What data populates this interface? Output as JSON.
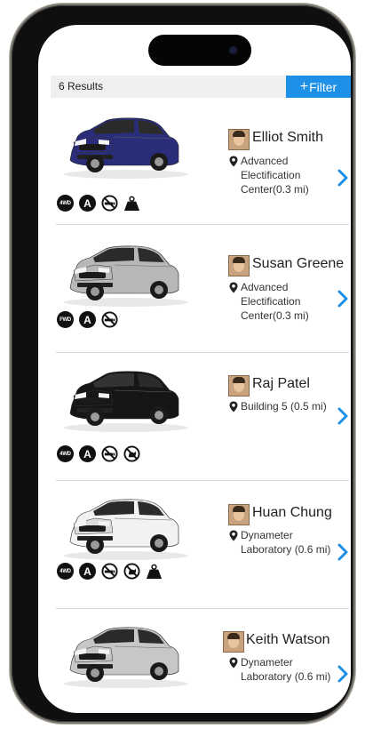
{
  "header": {
    "results_label": "6 Results",
    "filter_label": "Filter"
  },
  "colors": {
    "accent": "#1e90e8"
  },
  "vehicles": [
    {
      "driver": "Elliot Smith",
      "location_lines": [
        "Advanced",
        "Electification",
        "Center(0.3 mi)"
      ],
      "car_color": "#2a2e7a",
      "features": [
        "4WD",
        "A",
        "no-smoking-icon",
        "weight-icon"
      ]
    },
    {
      "driver": "Susan Greene",
      "location_lines": [
        "Advanced",
        "Electification",
        "Center(0.3 mi)"
      ],
      "car_color": "#b7b7b7",
      "features": [
        "FWD",
        "A",
        "no-smoking-icon"
      ]
    },
    {
      "driver": "Raj Patel",
      "location_lines": [
        "Building 5 (0.5 mi)"
      ],
      "car_color": "#161616",
      "features": [
        "4WD",
        "A",
        "no-smoking-icon",
        "no-pets-icon"
      ]
    },
    {
      "driver": "Huan Chung",
      "location_lines": [
        "Dynameter",
        "Laboratory (0.6 mi)"
      ],
      "car_color": "#f2f2f2",
      "features": [
        "4WD",
        "A",
        "no-smoking-icon",
        "no-pets-icon",
        "weight-icon"
      ]
    },
    {
      "driver": "Keith Watson",
      "location_lines": [
        "Dynameter",
        "Laboratory (0.6 mi)"
      ],
      "car_color": "#c7c7c7",
      "features": []
    }
  ]
}
